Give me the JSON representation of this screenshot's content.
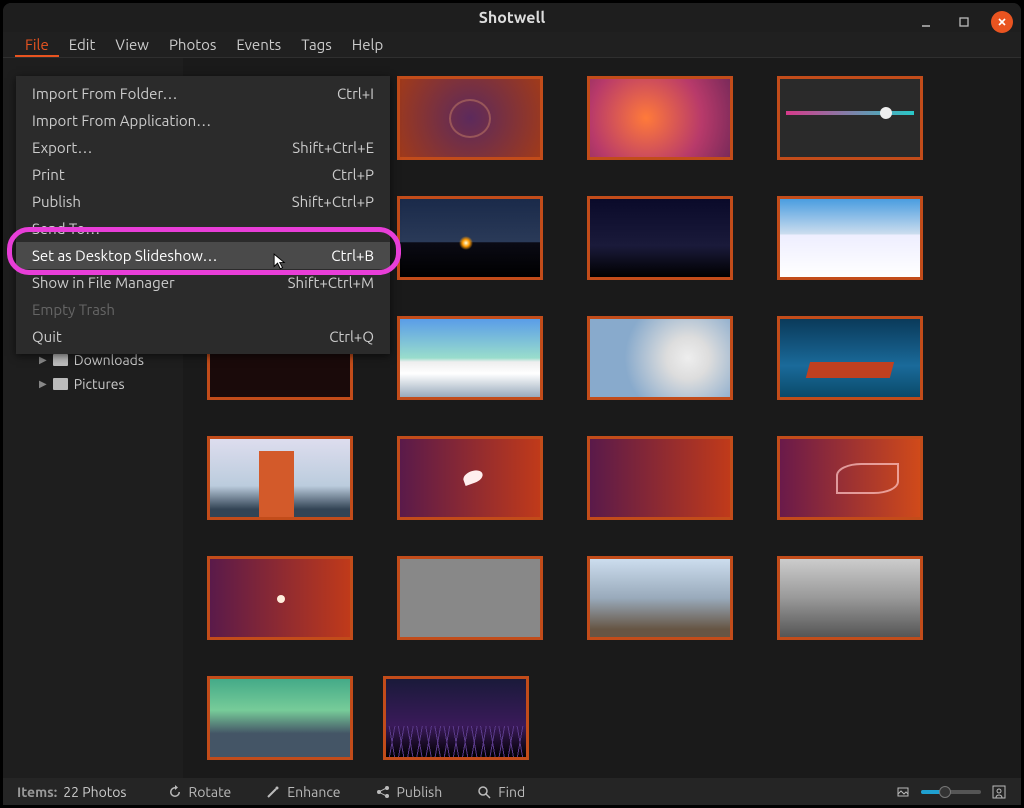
{
  "window": {
    "title": "Shotwell"
  },
  "menubar": {
    "items": [
      "File",
      "Edit",
      "View",
      "Photos",
      "Events",
      "Tags",
      "Help"
    ],
    "active_index": 0
  },
  "file_menu": {
    "items": [
      {
        "label": "Import From Folder…",
        "accel": "Ctrl+I",
        "enabled": true
      },
      {
        "label": "Import From Application…",
        "accel": "",
        "enabled": true
      },
      {
        "label": "Export…",
        "accel": "Shift+Ctrl+E",
        "enabled": true
      },
      {
        "label": "Print",
        "accel": "Ctrl+P",
        "enabled": true
      },
      {
        "label": "Publish",
        "accel": "Shift+Ctrl+P",
        "enabled": true
      },
      {
        "label": "Send To…",
        "accel": "",
        "enabled": true
      },
      {
        "label": "Set as Desktop Slideshow…",
        "accel": "Ctrl+B",
        "enabled": true,
        "highlighted": true
      },
      {
        "label": "Show in File Manager",
        "accel": "Shift+Ctrl+M",
        "enabled": true
      },
      {
        "label": "Empty Trash",
        "accel": "",
        "enabled": false
      },
      {
        "label": "Quit",
        "accel": "Ctrl+Q",
        "enabled": true
      }
    ]
  },
  "sidebar": {
    "items": [
      {
        "label": "Downloads"
      },
      {
        "label": "Pictures"
      }
    ]
  },
  "status": {
    "label": "Items:",
    "value": "22 Photos"
  },
  "toolbar": {
    "rotate": "Rotate",
    "enhance": "Enhance",
    "publish": "Publish",
    "find": "Find"
  }
}
